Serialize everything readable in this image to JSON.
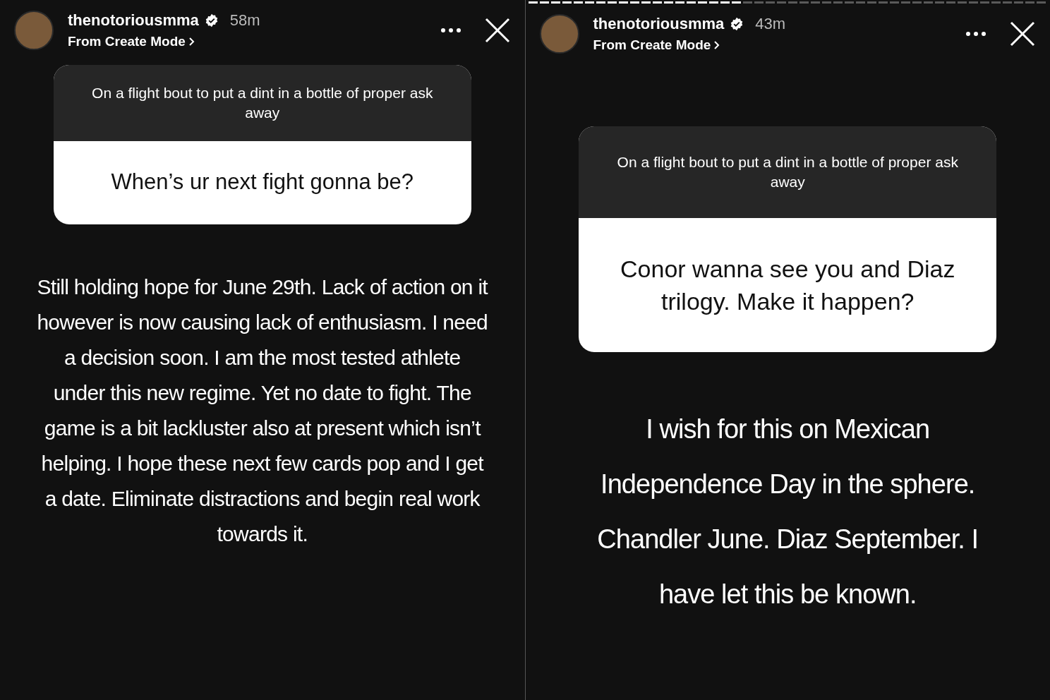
{
  "stories": [
    {
      "username": "thenotoriousmma",
      "verified": true,
      "time": "58m",
      "subtitle": "From Create Mode",
      "question_prompt": "On a flight bout to put a dint in a bottle of proper ask away",
      "question": "When’s ur next fight gonna be?",
      "answer": "Still holding hope for June 29th. Lack of action on it however is now causing lack of enthusiasm. I need a decision soon. I am the most tested athlete under this new regime. Yet no date to fight. The game is a bit lackluster also at present which isn’t helping. I hope these next few cards pop and I get a date. Eliminate distractions and begin real work towards it."
    },
    {
      "username": "thenotoriousmma",
      "verified": true,
      "time": "43m",
      "subtitle": "From Create Mode",
      "progress": {
        "level": 0.41
      },
      "question_prompt": "On a flight bout to put a dint in a bottle of proper ask away",
      "question": "Conor wanna see you and Diaz trilogy. Make it happen?",
      "answer": "I wish for this on Mexican Independence Day in the sphere. Chandler June. Diaz September. I have let this be known."
    }
  ]
}
